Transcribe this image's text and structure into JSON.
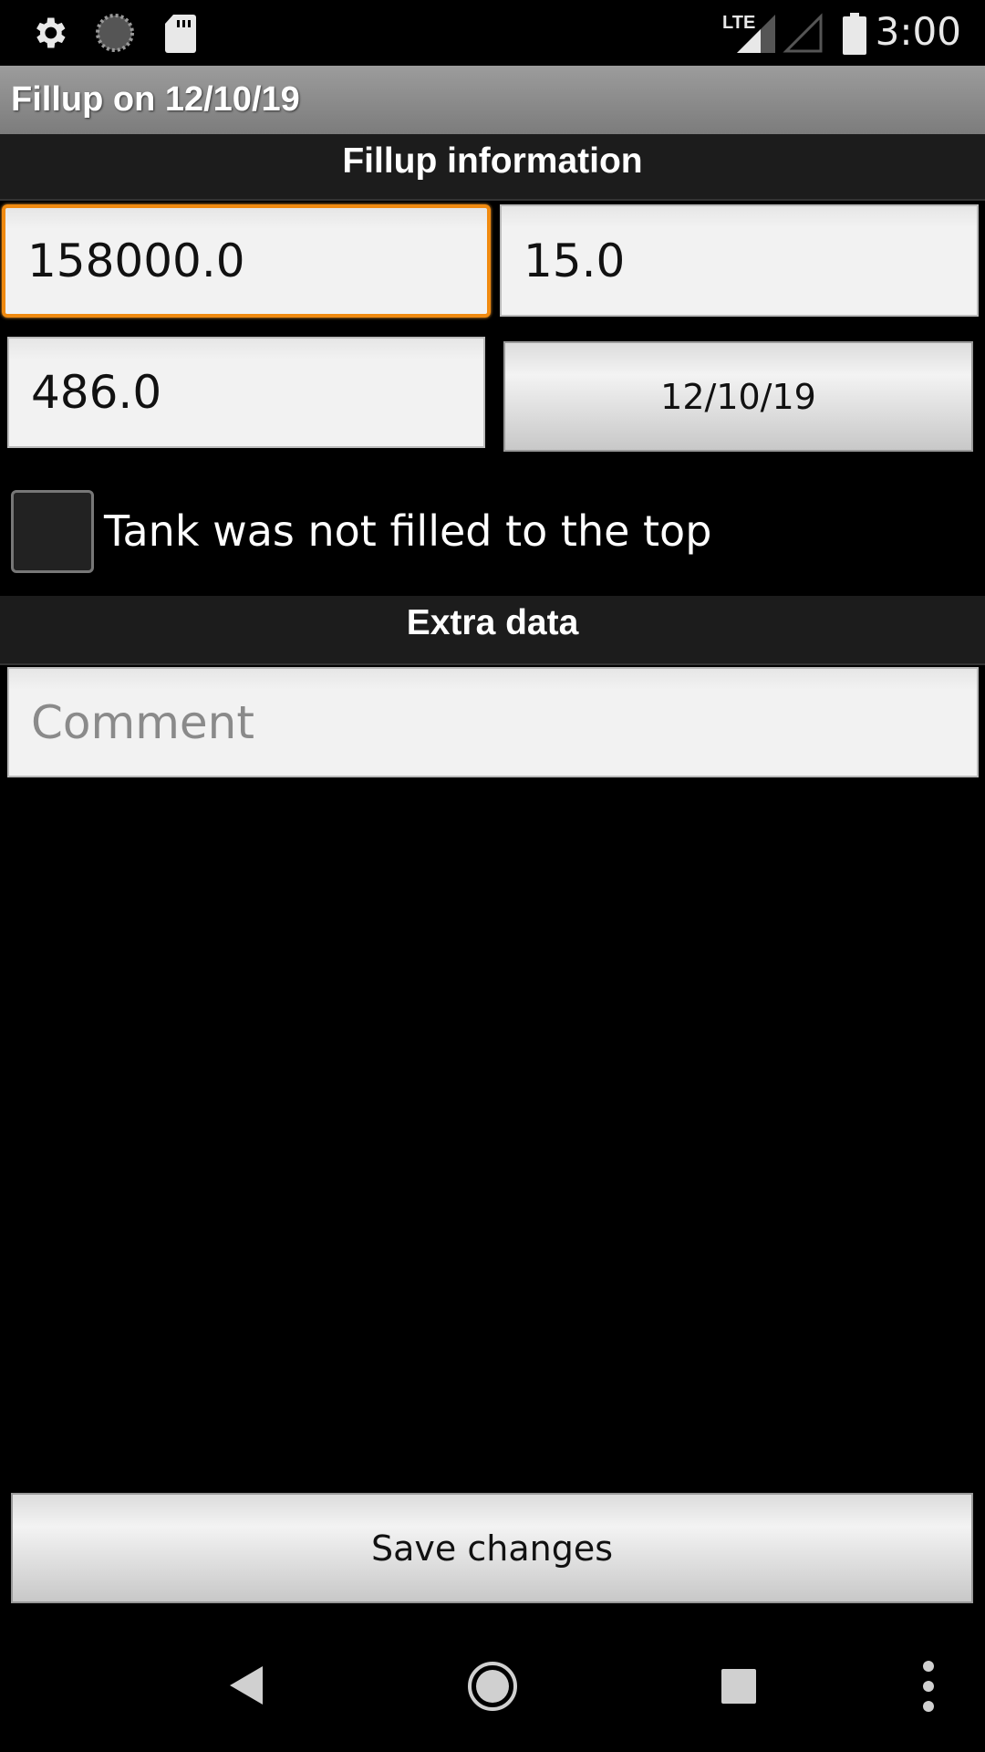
{
  "status_bar": {
    "left_icons": [
      "gear-icon",
      "sync-icon",
      "sd-card-icon"
    ],
    "right_icons": [
      "lte-signal-icon",
      "signal-empty-icon",
      "battery-icon"
    ],
    "network_label": "LTE",
    "time": "3:00"
  },
  "titlebar": {
    "title": "Fillup on 12/10/19"
  },
  "sections": {
    "fillup_info": "Fillup information",
    "extra_data": "Extra data"
  },
  "form": {
    "odometer": {
      "value": "158000.0",
      "focused": true
    },
    "volume": {
      "value": "15.0"
    },
    "price": {
      "value": "486.0"
    },
    "date_button": "12/10/19",
    "partial_checkbox": {
      "label": "Tank was not filled to the top",
      "checked": false
    },
    "comment": {
      "value": "",
      "placeholder": "Comment"
    }
  },
  "save_button": "Save changes",
  "nav_bar": [
    "back-icon",
    "home-icon",
    "recents-icon",
    "overflow-menu-icon"
  ],
  "colors": {
    "focus": "#f08a10",
    "section_bg": "#1c1c1c",
    "background": "#000000"
  }
}
